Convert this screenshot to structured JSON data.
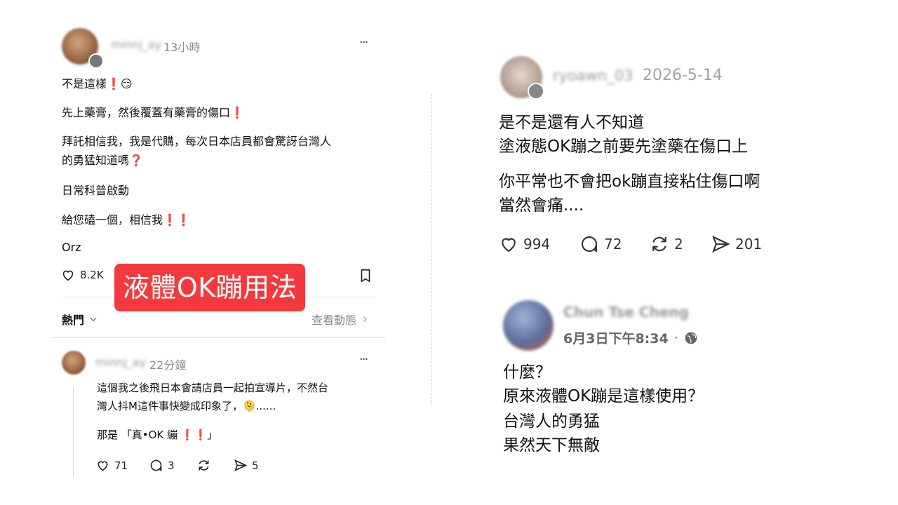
{
  "left_post": {
    "username": "minnj_ay",
    "time": "13小時",
    "more": "···",
    "paragraphs": [
      "不是這樣❗😏",
      "先上藥膏，然後覆蓋有藥膏的傷口❗",
      "拜託相信我，我是代購，每次日本店員都會驚訝台灣人",
      "的勇猛知道嗎❓",
      "日常科普啟動",
      "給您磕一個，相信我❗❗",
      "Orz"
    ],
    "likes": "8.2K",
    "sort_label": "熱門",
    "activity_link": "查看動態"
  },
  "banner": {
    "text": "液體OK蹦用法"
  },
  "left_reply": {
    "username": "minnj_ay",
    "time": "22分鐘",
    "more": "···",
    "line1": "這個我之後飛日本會請店員一起拍宣導片，不然台",
    "line2": "灣人抖M這件事快變成印象了，🫠......",
    "line3": "那是 「真•OK 繃 ❗❗」",
    "likes": "71",
    "comments": "3",
    "shares": "5"
  },
  "right_post1": {
    "username": "ryoawn_03",
    "date": "2026-5-14",
    "line1": "是不是還有人不知道",
    "line2": "塗液態OK蹦之前要先塗藥在傷口上",
    "line3": "你平常也不會把ok蹦直接粘住傷口啊",
    "line4": "當然會痛....",
    "likes": "994",
    "comments": "72",
    "reposts": "2",
    "shares": "201"
  },
  "right_post2": {
    "username": "Chun Tse Cheng",
    "datetime": "6月3日下午8:34",
    "dot": "·",
    "line1": "什麼？",
    "line2": "原來液體OK蹦是這樣使用？",
    "line3": "台灣人的勇猛",
    "line4": "果然天下無敵"
  },
  "icons": {
    "heart": "heart-icon",
    "comment": "comment-icon",
    "repost": "repost-icon",
    "share": "share-icon",
    "bookmark": "bookmark-icon",
    "globe": "globe-icon",
    "chevron": "chevron-icon"
  }
}
